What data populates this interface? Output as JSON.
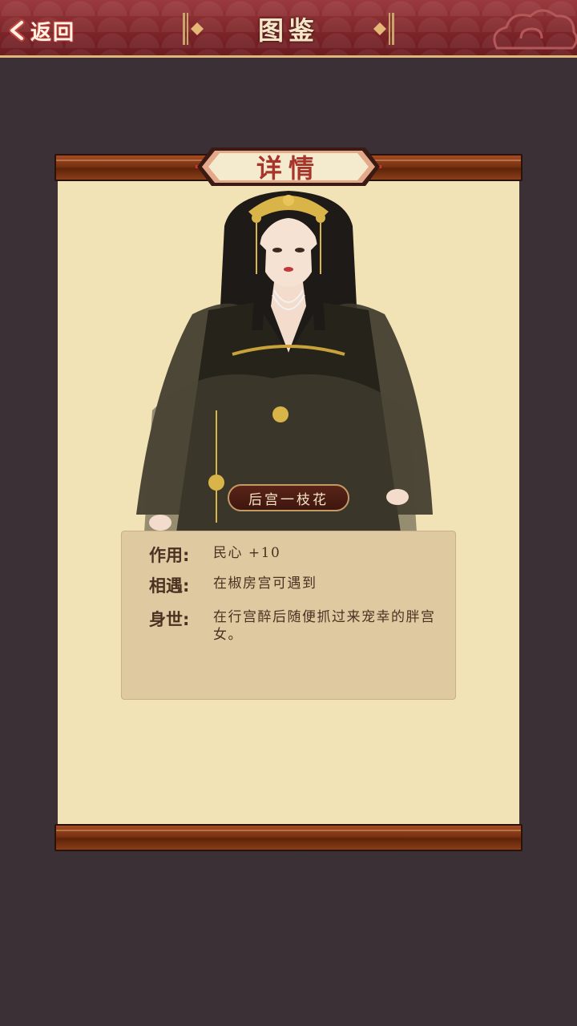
{
  "header": {
    "back_label": "返回",
    "title": "图鉴"
  },
  "scroll": {
    "tab_title": "详情"
  },
  "character": {
    "name": "后宫一枝花"
  },
  "info": {
    "effect_label": "作用:",
    "effect_value": "民心 +10",
    "encounter_label": "相遇:",
    "encounter_value": "在椒房宫可遇到",
    "background_label": "身世:",
    "background_value": "在行宫醉后随便抓过来宠幸的胖宫女。"
  },
  "colors": {
    "header_red": "#7c2428",
    "paper": "#f2e3b6",
    "rod_brown": "#7a3212",
    "info_bg": "#dfc9a1",
    "text_brown": "#4a3222",
    "tab_text_red": "#a8352c"
  }
}
